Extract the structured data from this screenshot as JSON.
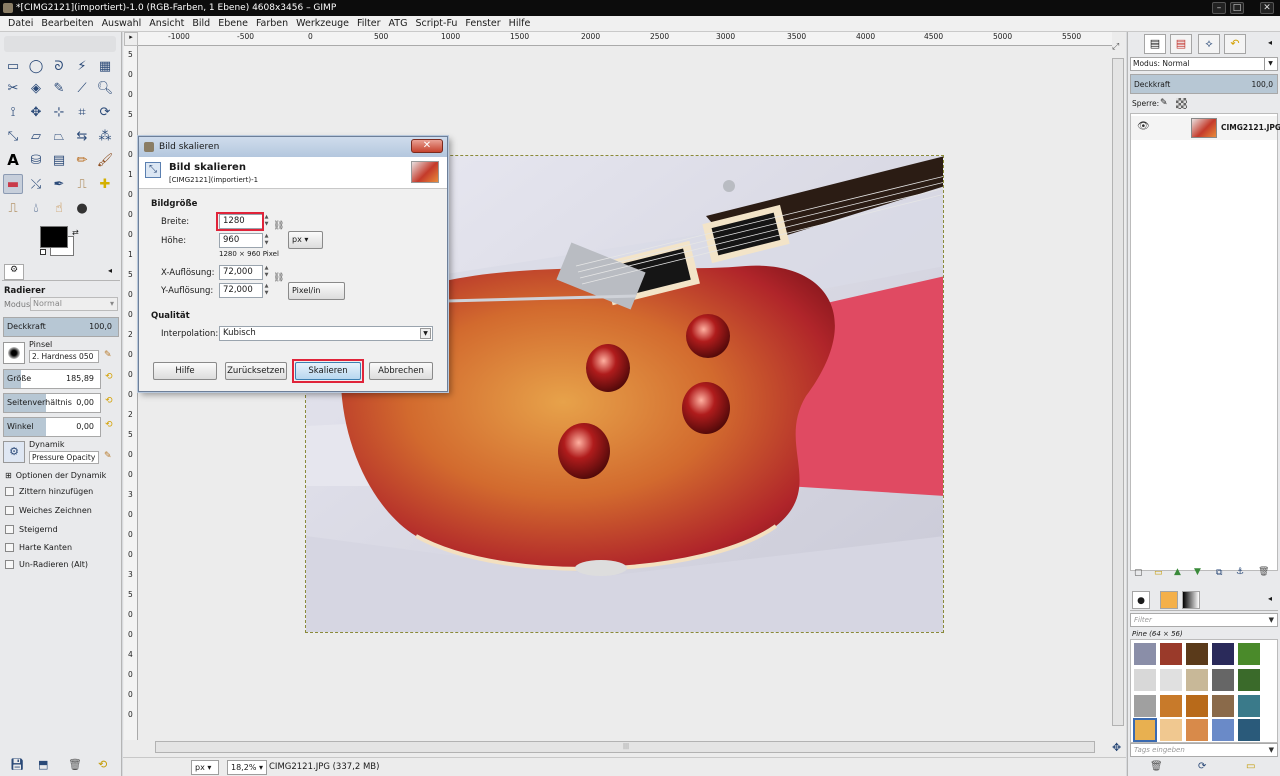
{
  "window": {
    "title": "*[CIMG2121](importiert)-1.0 (RGB-Farben, 1 Ebene) 4608x3456 – GIMP",
    "minimize": "–",
    "maximize": "□",
    "close": "✕"
  },
  "menu": [
    "Datei",
    "Bearbeiten",
    "Auswahl",
    "Ansicht",
    "Bild",
    "Ebene",
    "Farben",
    "Werkzeuge",
    "Filter",
    "ATG",
    "Script-Fu",
    "Fenster",
    "Hilfe"
  ],
  "toolbox": {
    "tool_name": "Radierer",
    "modus_label": "Modus:",
    "modus_value": "Normal",
    "deckkraft_label": "Deckkraft",
    "deckkraft_value": "100,0",
    "pinsel_label": "Pinsel",
    "pinsel_value": "2. Hardness 050",
    "groesse_label": "Größe",
    "groesse_value": "185,89",
    "seitenverhaeltnis_label": "Seitenverhältnis",
    "seitenverhaeltnis_value": "0,00",
    "winkel_label": "Winkel",
    "winkel_value": "0,00",
    "dynamik_label": "Dynamik",
    "dynamik_value": "Pressure Opacity",
    "optionen_dynamik": "Optionen der Dynamik",
    "checkboxes": [
      "Zittern hinzufügen",
      "Weiches Zeichnen",
      "Steigernd",
      "Harte Kanten",
      "Un-Radieren (Alt)"
    ]
  },
  "rulers": {
    "h_ticks": [
      "-1000",
      "-500",
      "0",
      "500",
      "1000",
      "1500",
      "2000",
      "2500",
      "3000",
      "3500",
      "4000",
      "4500",
      "5000",
      "5500"
    ],
    "v_ticks": [
      "5",
      "0",
      "0",
      "5",
      "0",
      "0",
      "1",
      "0",
      "0",
      "0",
      "1",
      "5",
      "0",
      "0",
      "2",
      "0",
      "0",
      "0",
      "2",
      "5",
      "0",
      "0",
      "3",
      "0",
      "0",
      "0",
      "3",
      "5",
      "0",
      "0",
      "4",
      "0",
      "0",
      "0"
    ]
  },
  "status": {
    "unit": "px",
    "zoom": "18,2%",
    "file_info": "CIMG2121.JPG (337,2 MB)"
  },
  "dialog": {
    "window_title": "Bild skalieren",
    "heading": "Bild skalieren",
    "subheading": "[CIMG2121](importiert)-1",
    "section_size": "Bildgröße",
    "breite_label": "Breite:",
    "breite_value": "1280",
    "hoehe_label": "Höhe:",
    "hoehe_value": "960",
    "pixel_info": "1280 × 960 Pixel",
    "size_unit": "px",
    "xres_label": "X-Auflösung:",
    "xres_value": "72,000",
    "yres_label": "Y-Auflösung:",
    "yres_value": "72,000",
    "res_unit": "Pixel/in",
    "section_quality": "Qualität",
    "interp_label": "Interpolation:",
    "interp_value": "Kubisch",
    "btn_help": "Hilfe",
    "btn_reset": "Zurücksetzen",
    "btn_scale": "Skalieren",
    "btn_cancel": "Abbrechen"
  },
  "layers": {
    "modus_label": "Modus:",
    "modus_value": "Normal",
    "deckkraft_label": "Deckkraft",
    "deckkraft_value": "100,0",
    "sperre_label": "Sperre:",
    "layer_name": "CIMG2121.JPG"
  },
  "patterns": {
    "filter_placeholder": "Filter",
    "selected": "Pine (64 × 56)",
    "tags_placeholder": "Tags eingeben"
  },
  "colors": {
    "accent_highlight": "#e0243a",
    "selected_button": "#cfe4f7"
  }
}
